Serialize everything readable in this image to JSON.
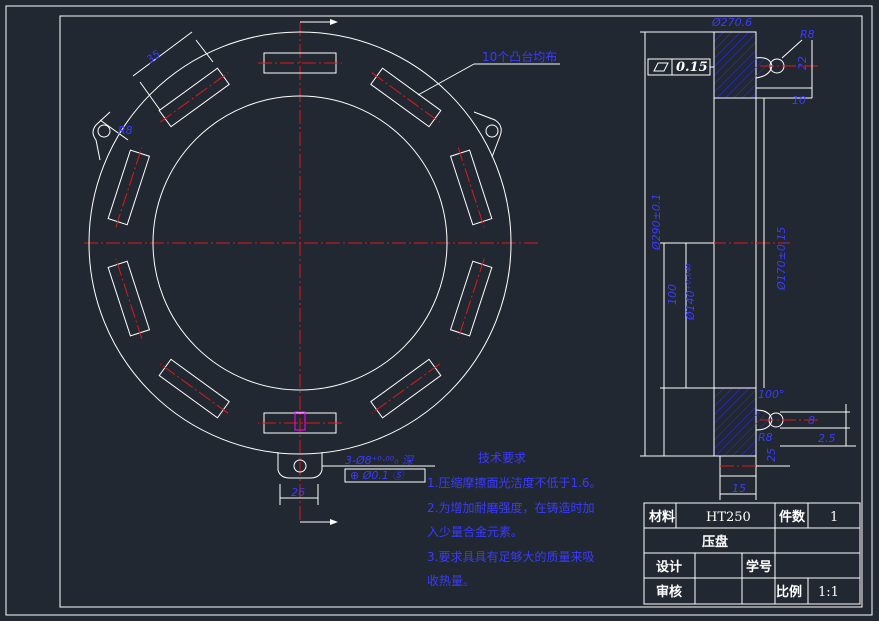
{
  "dimensions": {
    "slot_width": "35",
    "slot_radius_left": "R8",
    "slot_callout": "10个凸台均布",
    "lug_slot_width": "26",
    "hole_spec": "3-Ø8⁺⁰·⁰⁰₀ 深",
    "position_tol": "⊕ Ø0.1 Ⓢ",
    "flatness": "0.15",
    "top_dia": "Ø270.6",
    "outer_dia": "Ø290±0.1",
    "inner_dia": "Ø140⁺⁰·⁰⁴⁰",
    "mid_dia": "Ø170±0.15",
    "length_100": "100",
    "r8_top": "R8",
    "r8_bottom": "R8",
    "dim_10": "10",
    "dim_22": "22",
    "dim_25": "25",
    "dim_8": "8",
    "dim_25b": "2.5",
    "dim_100_small": "100°",
    "dim_15": "15"
  },
  "notes": {
    "title": "技术要求",
    "line1": "1.压缩摩擦面光洁度不低于1.6。",
    "line2": "2.为增加耐磨强度，在铸造时加",
    "line3": "入少量合金元素。",
    "line4": "3.要求具具有足够大的质量来吸",
    "line5": "收热量。"
  },
  "title_block": {
    "material_label": "材料",
    "material_value": "HT250",
    "count_label": "件数",
    "count_value": "1",
    "part_name": "压盘",
    "design_label": "设计",
    "student_label": "学号",
    "review_label": "审核",
    "scale_label": "比例",
    "scale_value": "1:1"
  },
  "colors": {
    "background": "#222831",
    "outline": "#ffffff",
    "centerline": "#e01818",
    "dimension": "#2222ee"
  }
}
